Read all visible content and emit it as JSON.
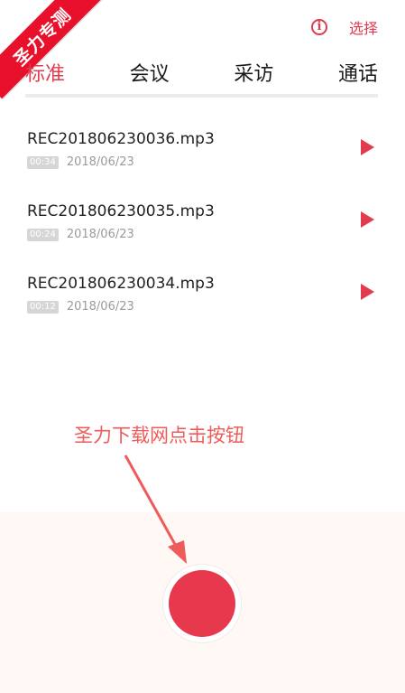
{
  "watermark": {
    "ribbon_text": "圣力专测"
  },
  "header": {
    "select_label": "选择",
    "info_icon": "info-circle-icon"
  },
  "tabs": [
    {
      "label": "标准",
      "active": true
    },
    {
      "label": "会议",
      "active": false
    },
    {
      "label": "采访",
      "active": false
    },
    {
      "label": "通话",
      "active": false
    }
  ],
  "recordings": [
    {
      "name": "REC201806230036.mp3",
      "duration": "00:34",
      "date": "2018/06/23"
    },
    {
      "name": "REC201806230035.mp3",
      "duration": "00:24",
      "date": "2018/06/23"
    },
    {
      "name": "REC201806230034.mp3",
      "duration": "00:12",
      "date": "2018/06/23"
    }
  ],
  "annotation": {
    "text": "圣力下载网点击按钮"
  },
  "colors": {
    "accent": "#e23a4e",
    "record": "#e8384d",
    "annotation": "#ef5a5a"
  }
}
